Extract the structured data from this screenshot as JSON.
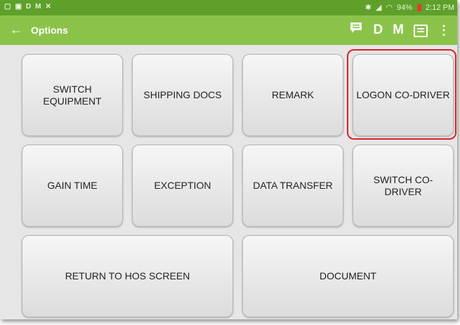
{
  "status_bar": {
    "left_icons": [
      "D",
      "M"
    ],
    "battery": "94%",
    "time": "2:12 PM"
  },
  "app_bar": {
    "back_icon": "arrow-left-icon",
    "title": "Options",
    "action_d": "D",
    "action_m": "M"
  },
  "buttons": {
    "switch_equipment": "SWITCH\nEQUIPMENT",
    "shipping_docs": "SHIPPING DOCS",
    "remark": "REMARK",
    "logon_co_driver": "LOGON CO-DRIVER",
    "gain_time": "GAIN TIME",
    "exception": "EXCEPTION",
    "data_transfer": "DATA TRANSFER",
    "switch_co_driver": "SWITCH CO-\nDRIVER",
    "return_to_hos": "RETURN TO HOS SCREEN",
    "document": "DOCUMENT"
  },
  "highlight": {
    "color": "#e02020"
  }
}
